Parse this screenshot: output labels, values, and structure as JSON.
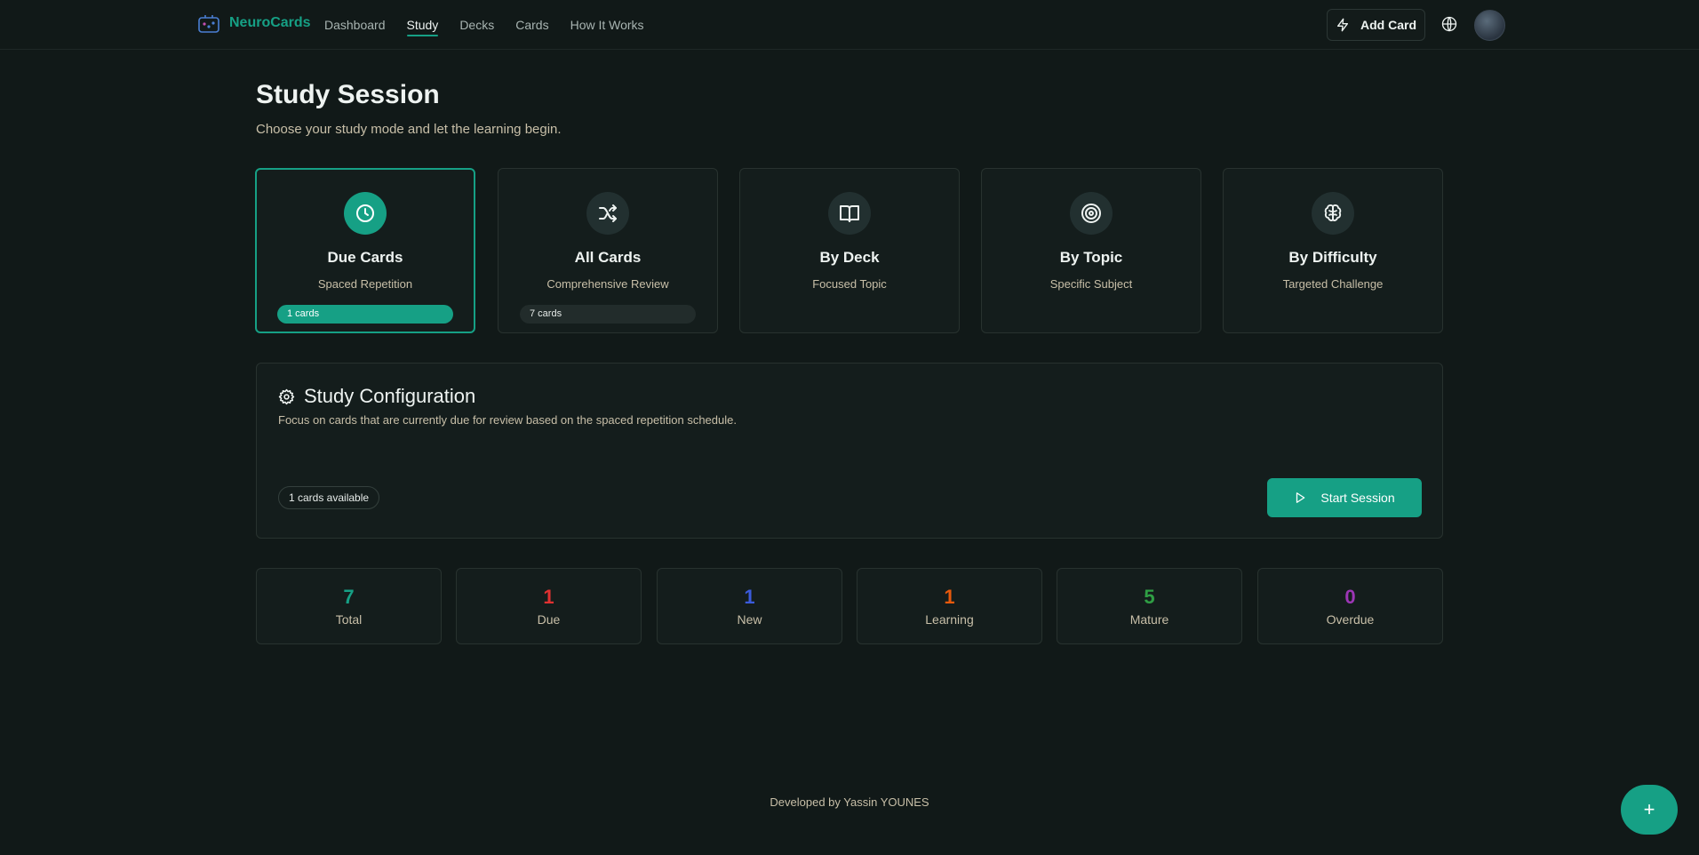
{
  "brand": {
    "name": "NeuroCards",
    "logo_icon": "robot-cards-icon"
  },
  "nav": [
    {
      "label": "Dashboard",
      "active": false
    },
    {
      "label": "Study",
      "active": true
    },
    {
      "label": "Decks",
      "active": false
    },
    {
      "label": "Cards",
      "active": false
    },
    {
      "label": "How It Works",
      "active": false
    }
  ],
  "header": {
    "add_card_label": "Add Card"
  },
  "page": {
    "title": "Study Session",
    "subtitle": "Choose your study mode and let the learning begin."
  },
  "modes": [
    {
      "title": "Due Cards",
      "subtitle": "Spaced Repetition",
      "badge": "1 cards",
      "icon": "clock-icon",
      "selected": true
    },
    {
      "title": "All Cards",
      "subtitle": "Comprehensive Review",
      "badge": "7 cards",
      "icon": "shuffle-icon",
      "selected": false
    },
    {
      "title": "By Deck",
      "subtitle": "Focused Topic",
      "icon": "book-open-icon",
      "selected": false
    },
    {
      "title": "By Topic",
      "subtitle": "Specific Subject",
      "icon": "target-icon",
      "selected": false
    },
    {
      "title": "By Difficulty",
      "subtitle": "Targeted Challenge",
      "icon": "brain-icon",
      "selected": false
    }
  ],
  "config": {
    "title": "Study Configuration",
    "description": "Focus on cards that are currently due for review based on the spaced repetition schedule.",
    "available": "1 cards available",
    "start_label": "Start Session"
  },
  "stats": [
    {
      "value": "7",
      "label": "Total",
      "color": "#16a085"
    },
    {
      "value": "1",
      "label": "Due",
      "color": "#e03131"
    },
    {
      "value": "1",
      "label": "New",
      "color": "#3b5bdb"
    },
    {
      "value": "1",
      "label": "Learning",
      "color": "#e8590c"
    },
    {
      "value": "5",
      "label": "Mature",
      "color": "#2f9e44"
    },
    {
      "value": "0",
      "label": "Overdue",
      "color": "#9c36b5"
    }
  ],
  "footer": {
    "text": "Developed by Yassin YOUNES"
  },
  "fab": {
    "label": "+"
  },
  "colors": {
    "accent": "#16a085",
    "background": "#111918",
    "card": "#141d1c"
  }
}
